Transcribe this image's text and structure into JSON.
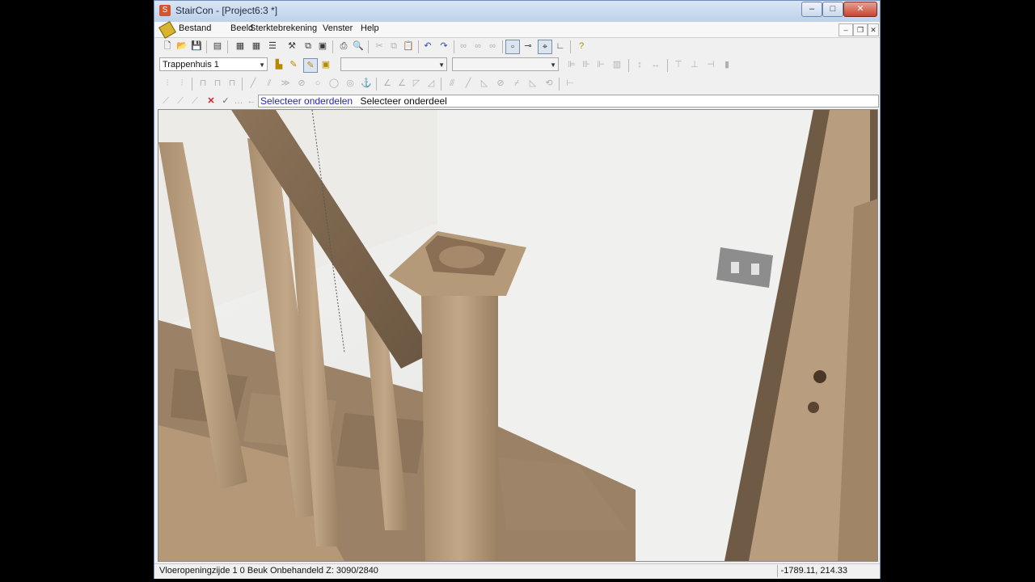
{
  "window": {
    "title": "StairCon - [Project6:3 *]",
    "app_icon": "staircon-logo-icon",
    "controls": {
      "minimize": "–",
      "maximize": "□",
      "close": "✕"
    }
  },
  "menubar": {
    "icon": "staircon-menu-icon",
    "items": [
      "Bestand",
      "Beeld",
      "Sterktebrekening",
      "Venster",
      "Help"
    ],
    "mdi_controls": {
      "minimize": "–",
      "restore": "❐",
      "close": "✕"
    }
  },
  "toolbar2": {
    "view_select": "Trappenhuis 1",
    "combo2": "",
    "combo3": ""
  },
  "command": {
    "link_text": "Selecteer onderdelen",
    "prompt_text": "Selecteer onderdeel"
  },
  "statusbar": {
    "left": "Vloeropeningzijde 1 0 Beuk Onbehandeld Z: 3090/2840",
    "right": "-1789.11, 214.33"
  },
  "colors": {
    "wood_light": "#b79d7c",
    "wood_dark": "#6e5a45",
    "wall": "#eeeeec",
    "prompt_link": "#2424b8"
  }
}
